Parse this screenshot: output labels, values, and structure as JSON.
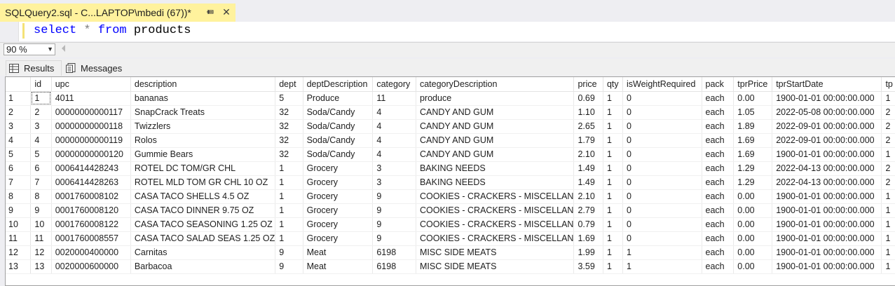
{
  "doc_tab": {
    "title": "SQLQuery2.sql - C...LAPTOP\\mbedi (67))*",
    "pin_icon": "pin-icon",
    "close_label": "✕"
  },
  "editor": {
    "kw1": "select",
    "op": "*",
    "kw2": "from",
    "table": "products"
  },
  "zoom": {
    "value": "90 %"
  },
  "result_tabs": [
    {
      "label": "Results",
      "icon": "grid-icon"
    },
    {
      "label": "Messages",
      "icon": "messages-icon"
    }
  ],
  "grid": {
    "columns": [
      "id",
      "upc",
      "description",
      "dept",
      "deptDescription",
      "category",
      "categoryDescription",
      "price",
      "qty",
      "isWeightRequired",
      "pack",
      "tprPrice",
      "tprStartDate",
      "tp"
    ],
    "rows": [
      [
        "1",
        "1",
        "4011",
        "bananas",
        "5",
        "Produce",
        "11",
        "produce",
        "0.69",
        "1",
        "0",
        "each",
        "0.00",
        "1900-01-01 00:00:00.000",
        "1"
      ],
      [
        "2",
        "2",
        "00000000000117",
        "SnapCrack Treats",
        "32",
        "Soda/Candy",
        "4",
        "CANDY AND GUM",
        "1.10",
        "1",
        "0",
        "each",
        "1.05",
        "2022-05-08 00:00:00.000",
        "2"
      ],
      [
        "3",
        "3",
        "00000000000118",
        "Twizzlers",
        "32",
        "Soda/Candy",
        "4",
        "CANDY AND GUM",
        "2.65",
        "1",
        "0",
        "each",
        "1.89",
        "2022-09-01 00:00:00.000",
        "2"
      ],
      [
        "4",
        "4",
        "00000000000119",
        "Rolos",
        "32",
        "Soda/Candy",
        "4",
        "CANDY AND GUM",
        "1.79",
        "1",
        "0",
        "each",
        "1.69",
        "2022-09-01 00:00:00.000",
        "2"
      ],
      [
        "5",
        "5",
        "00000000000120",
        "Gummie Bears",
        "32",
        "Soda/Candy",
        "4",
        "CANDY AND GUM",
        "2.10",
        "1",
        "0",
        "each",
        "1.69",
        "1900-01-01 00:00:00.000",
        "1"
      ],
      [
        "6",
        "6",
        "0006414428243",
        "ROTEL DC TOM/GR CHL",
        "1",
        "Grocery",
        "3",
        "BAKING NEEDS",
        "1.49",
        "1",
        "0",
        "each",
        "1.29",
        "2022-04-13 00:00:00.000",
        "2"
      ],
      [
        "7",
        "7",
        "0006414428263",
        "ROTEL MLD TOM GR CHL 10 OZ",
        "1",
        "Grocery",
        "3",
        "BAKING NEEDS",
        "1.49",
        "1",
        "0",
        "each",
        "1.29",
        "2022-04-13 00:00:00.000",
        "2"
      ],
      [
        "8",
        "8",
        "0001760008102",
        "CASA TACO SHELLS 4.5 OZ",
        "1",
        "Grocery",
        "9",
        "COOKIES - CRACKERS - MISCELLAN",
        "2.10",
        "1",
        "0",
        "each",
        "0.00",
        "1900-01-01 00:00:00.000",
        "1"
      ],
      [
        "9",
        "9",
        "0001760008120",
        "CASA TACO DINNER 9.75 OZ",
        "1",
        "Grocery",
        "9",
        "COOKIES - CRACKERS - MISCELLAN",
        "2.79",
        "1",
        "0",
        "each",
        "0.00",
        "1900-01-01 00:00:00.000",
        "1"
      ],
      [
        "10",
        "10",
        "0001760008122",
        "CASA TACO SEASONING 1.25 OZ",
        "1",
        "Grocery",
        "9",
        "COOKIES - CRACKERS - MISCELLAN",
        "0.79",
        "1",
        "0",
        "each",
        "0.00",
        "1900-01-01 00:00:00.000",
        "1"
      ],
      [
        "11",
        "11",
        "0001760008557",
        "CASA TACO SALAD SEAS 1.25 OZ",
        "1",
        "Grocery",
        "9",
        "COOKIES - CRACKERS - MISCELLAN",
        "1.69",
        "1",
        "0",
        "each",
        "0.00",
        "1900-01-01 00:00:00.000",
        "1"
      ],
      [
        "12",
        "12",
        "0020000400000",
        "Carnitas",
        "9",
        "Meat",
        "6198",
        "MISC SIDE MEATS",
        "1.99",
        "1",
        "1",
        "each",
        "0.00",
        "1900-01-01 00:00:00.000",
        "1"
      ],
      [
        "13",
        "13",
        "0020000600000",
        "Barbacoa",
        "9",
        "Meat",
        "6198",
        "MISC SIDE MEATS",
        "3.59",
        "1",
        "1",
        "each",
        "0.00",
        "1900-01-01 00:00:00.000",
        "1"
      ]
    ]
  },
  "colors": {
    "active_tab": "#fff29d",
    "keyword": "#0000ff",
    "operator": "#808080",
    "background": "#eeeef2"
  }
}
